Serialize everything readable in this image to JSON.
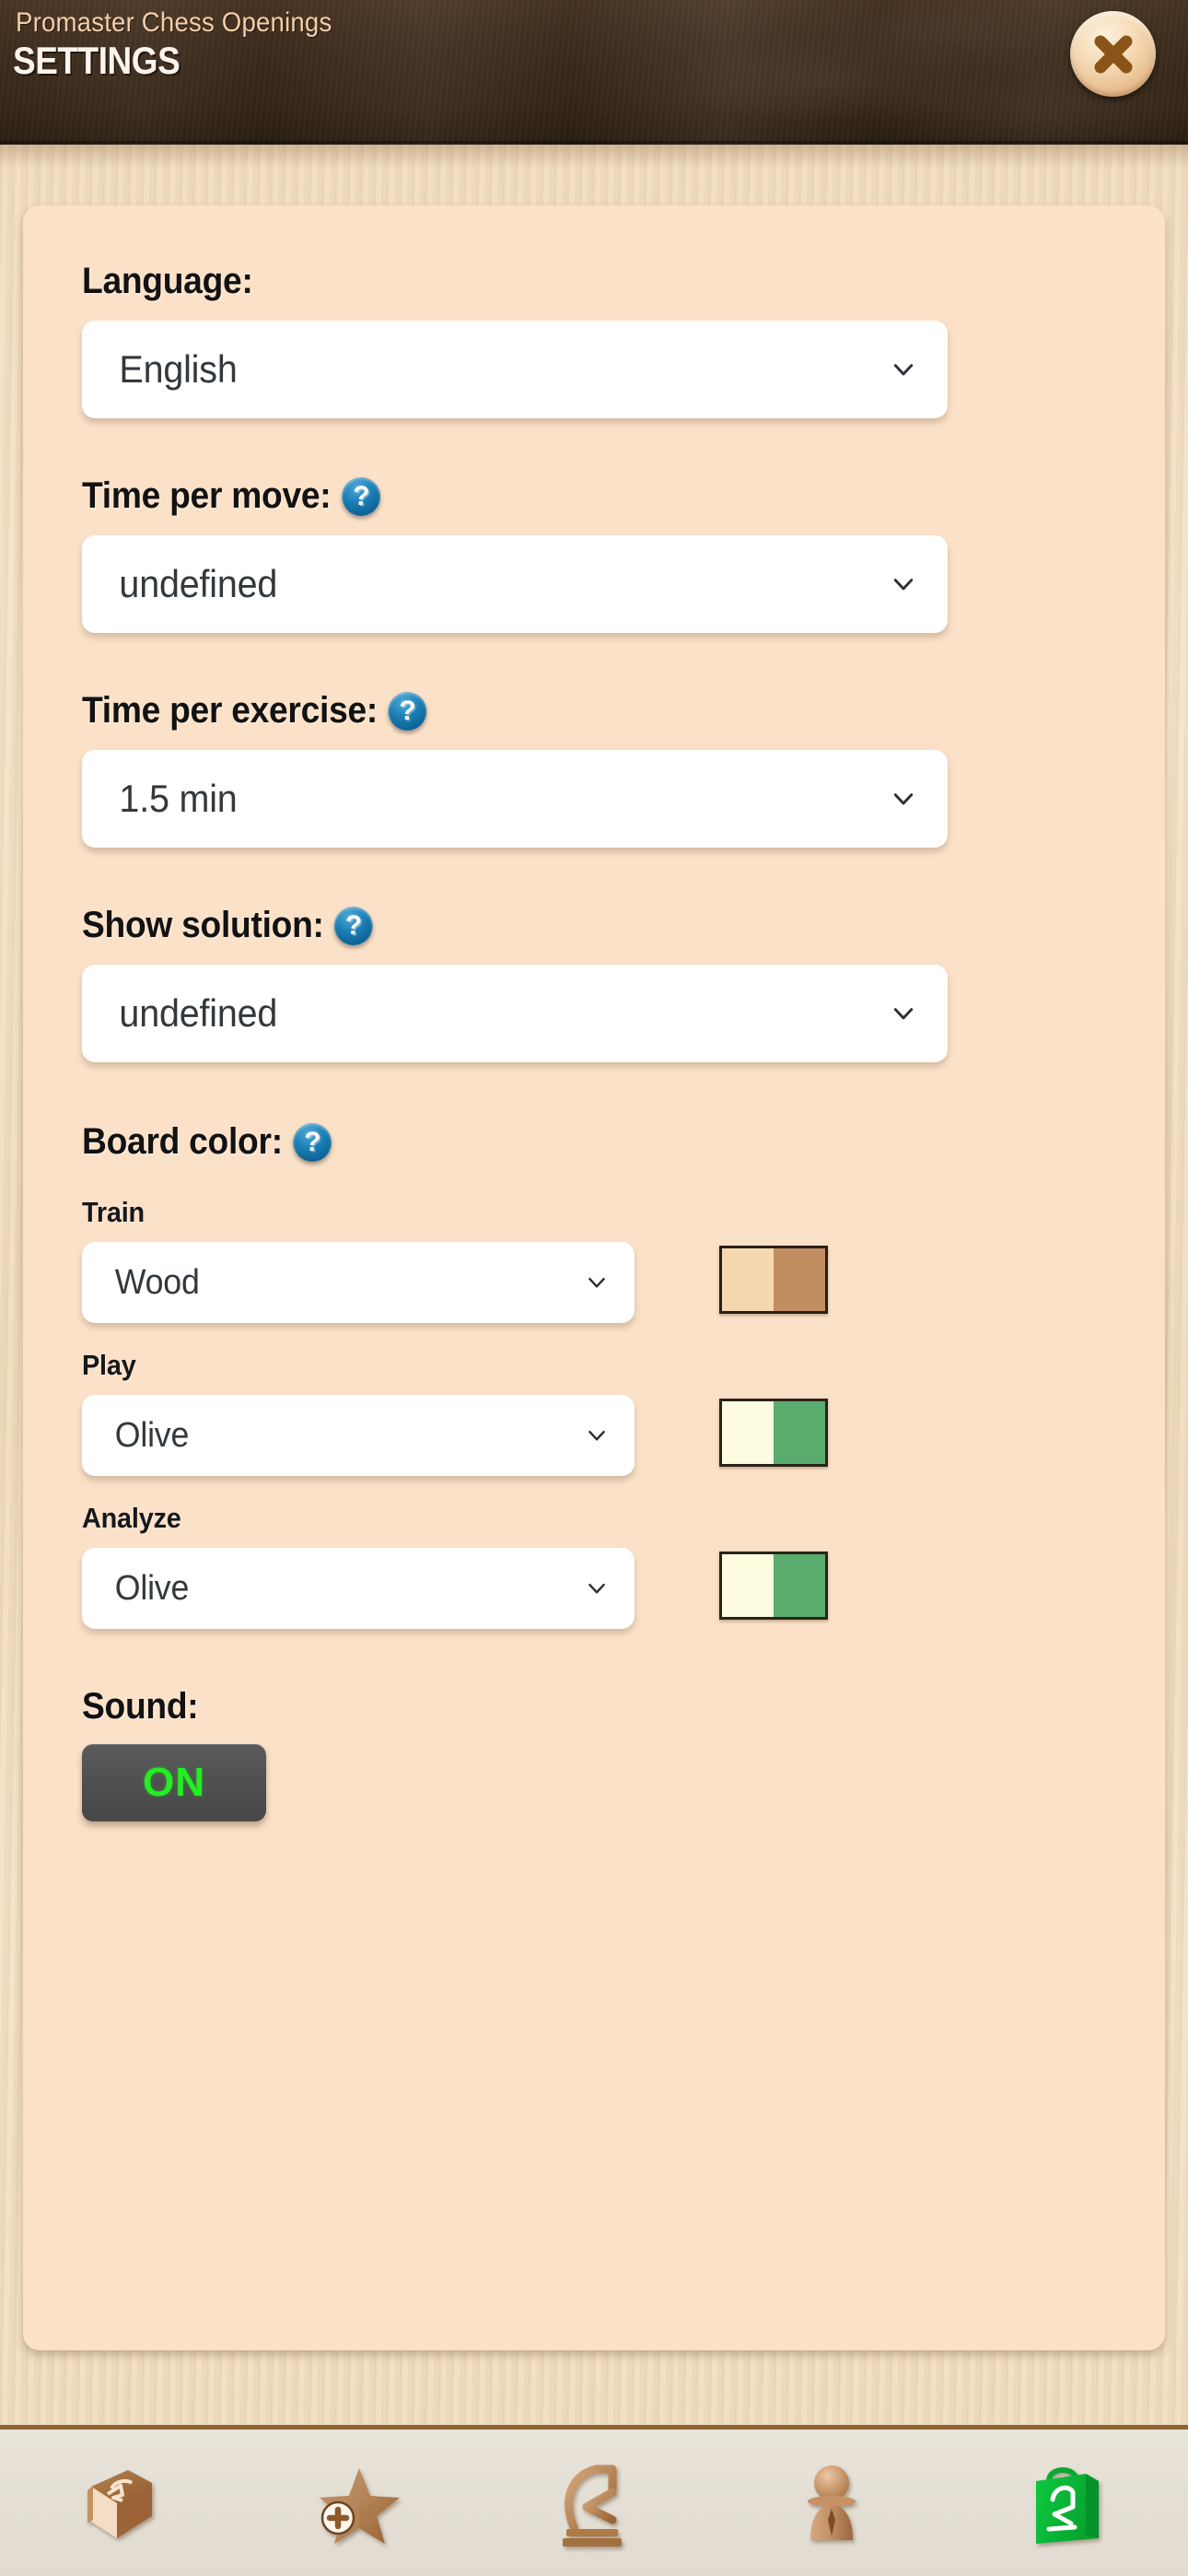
{
  "header": {
    "app_title": "Promaster Chess Openings",
    "screen_title": "SETTINGS",
    "close_label": "×"
  },
  "settings": {
    "language": {
      "label": "Language:",
      "value": "English",
      "has_help": false
    },
    "time_per_move": {
      "label": "Time per move:",
      "value": "undefined",
      "has_help": true,
      "help_glyph": "?"
    },
    "time_per_exercise": {
      "label": "Time per exercise:",
      "value": "1.5 min",
      "has_help": true,
      "help_glyph": "?"
    },
    "show_solution": {
      "label": "Show solution:",
      "value": "undefined",
      "has_help": true,
      "help_glyph": "?"
    },
    "board_color": {
      "label": "Board color:",
      "help_glyph": "?",
      "rows": [
        {
          "name": "Train",
          "value": "Wood",
          "swatch_light": "#f5d8b0",
          "swatch_dark": "#c28d60",
          "style": "wood"
        },
        {
          "name": "Play",
          "value": "Olive",
          "swatch_light": "#fcfce0",
          "swatch_dark": "#59ac6d",
          "style": "olive"
        },
        {
          "name": "Analyze",
          "value": "Olive",
          "swatch_light": "#fcfce0",
          "swatch_dark": "#59ac6d",
          "style": "olive"
        }
      ]
    },
    "sound": {
      "label": "Sound:",
      "state": "ON",
      "on_color": "#22ee22"
    }
  },
  "bottom_nav": {
    "items": [
      {
        "icon": "book-icon",
        "color": "#a9703f"
      },
      {
        "icon": "star-plus-icon",
        "color": "#b5885f"
      },
      {
        "icon": "knight-icon",
        "color": "#bf8f63"
      },
      {
        "icon": "pawn-icon",
        "color": "#c08f66"
      },
      {
        "icon": "shopping-bag-icon",
        "color": "#10b63b"
      }
    ]
  },
  "theme": {
    "card_bg": "#fbe1c8",
    "header_bg": "#3a2a1a",
    "help_blue": "#0d6092",
    "nav_bg": "#e4dfd5"
  }
}
